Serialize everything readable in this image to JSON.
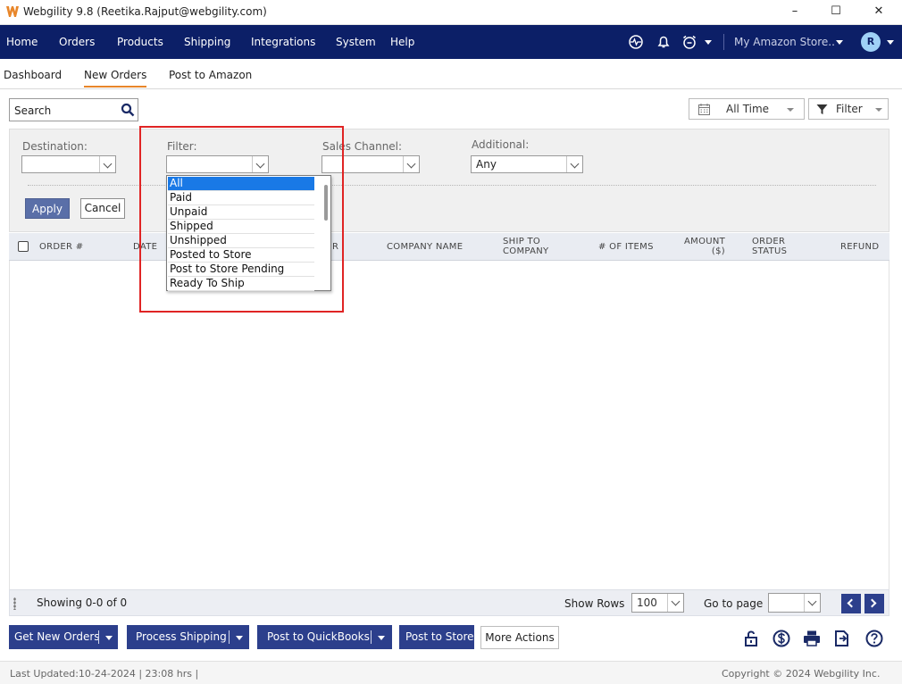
{
  "window": {
    "title": "Webgility 9.8 (Reetika.Rajput@webgility.com)",
    "controls": [
      "–",
      "☐",
      "✕"
    ]
  },
  "nav": {
    "items": [
      "Home",
      "Orders",
      "Products",
      "Shipping",
      "Integrations",
      "System",
      "Help"
    ],
    "store": "My Amazon Store..",
    "avatar": "R"
  },
  "subtabs": [
    "Dashboard",
    "New Orders",
    "Post to Amazon"
  ],
  "toolbar": {
    "search_label": "Search",
    "time_range": "All Time",
    "filter_label": "Filter"
  },
  "filters": {
    "destination_label": "Destination:",
    "filter_label": "Filter:",
    "sales_channel_label": "Sales Channel:",
    "additional_label": "Additional:",
    "additional_value": "Any",
    "apply_label": "Apply",
    "cancel_label": "Cancel",
    "filter_options": [
      "All",
      "Paid",
      "Unpaid",
      "Shipped",
      "Unshipped",
      "Posted to Store",
      "Post to Store Pending",
      "Ready To Ship"
    ],
    "selected_option": "All"
  },
  "table": {
    "columns": {
      "order": "ORDER #",
      "date": "DATE",
      "customer_tail": "R",
      "company": "COMPANY NAME",
      "ship_to_1": "SHIP TO",
      "ship_to_2": "COMPANY",
      "items": "# OF ITEMS",
      "amount_1": "AMOUNT",
      "amount_2": "($)",
      "status_1": "ORDER",
      "status_2": "STATUS",
      "refund": "REFUND"
    }
  },
  "pager": {
    "showing": "Showing 0-0 of 0",
    "show_rows_label": "Show Rows",
    "rows_value": "100",
    "go_to_page_label": "Go to page"
  },
  "actions": {
    "get_new_orders": "Get New Orders",
    "process_shipping": "Process Shipping",
    "post_to_quickbooks": "Post to QuickBooks",
    "post_to_store": "Post to Store",
    "more_actions": "More Actions"
  },
  "status": {
    "last_updated": "Last Updated:10-24-2024 | 23:08 hrs |",
    "copyright": "Copyright © 2024 Webgility Inc."
  },
  "colors": {
    "nav_bg": "#0c1f67",
    "action_btn": "#2c3f8c",
    "selected_option": "#1979e6",
    "active_tab": "#e8862a",
    "highlight": "#e02424"
  }
}
